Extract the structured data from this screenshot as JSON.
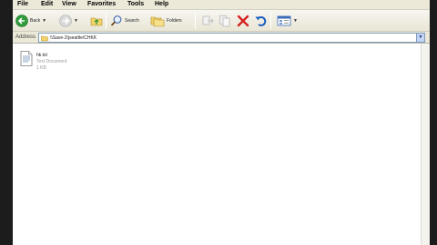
{
  "menu": [
    "File",
    "Edit",
    "View",
    "Favorites",
    "Tools",
    "Help"
  ],
  "toolbar": {
    "back_label": "Back",
    "search_label": "Search",
    "folders_label": "Folders"
  },
  "address": {
    "label": "Address",
    "value": "\\\\Save-2\\jseattle\\CHKK"
  },
  "file": {
    "name": "hk.txt",
    "type": "Text Document",
    "size": "1 KB"
  },
  "colors": {
    "undo_arrow": "#1c5fc2",
    "delete_x": "#d62020",
    "back_circle": "#2f9b3a"
  }
}
